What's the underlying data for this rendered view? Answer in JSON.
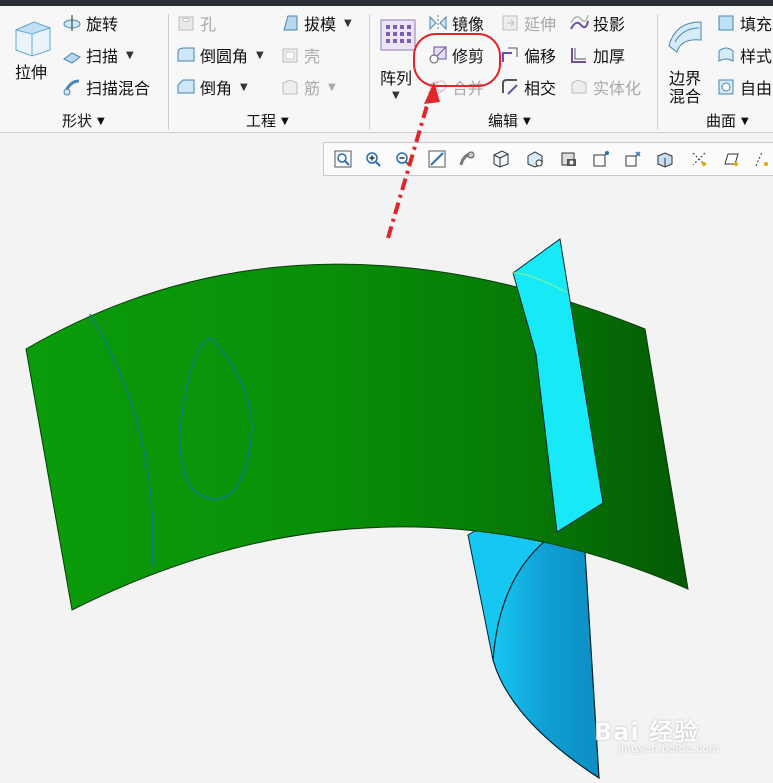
{
  "ribbon": {
    "shape_group": {
      "label": "形状",
      "extrude": "拉伸",
      "revolve": "旋转",
      "sweep": "扫描",
      "swept_blend": "扫描混合"
    },
    "engineering_group": {
      "label": "工程",
      "hole": "孔",
      "round": "倒圆角",
      "chamfer": "倒角",
      "draft": "拔模",
      "shell": "壳",
      "rib": "筋"
    },
    "edit_group": {
      "label": "编辑",
      "pattern": "阵列",
      "mirror": "镜像",
      "trim": "修剪",
      "merge": "合并",
      "extend": "延伸",
      "offset": "偏移",
      "intersect": "相交",
      "project": "投影",
      "thicken": "加厚",
      "solidify": "实体化"
    },
    "surface_group": {
      "label": "曲面",
      "boundary_blend_line1": "边界",
      "boundary_blend_line2": "混合",
      "fill": "填充",
      "style": "样式",
      "freestyle": "自由"
    }
  },
  "view_toolbar": {
    "icons": [
      "refit-icon",
      "zoom-in-icon",
      "zoom-out-icon",
      "repaint-icon",
      "spin-center-icon",
      "display-style-icon",
      "saved-views-icon",
      "view-manager-icon",
      "perspective-icon",
      "datum-display-icon",
      "axis-display-icon",
      "annotation-display-icon",
      "point-display-icon",
      "csys-display-icon",
      "plane-display-icon"
    ]
  },
  "watermark": {
    "text": "Bai 经验",
    "sub": "jingyan.baidu.com"
  },
  "colors": {
    "surface_green": "#0b9e0b",
    "surface_green_dark": "#045f04",
    "trim_surface_cyan": "#17e9f7",
    "highlight_red": "#e0262b"
  }
}
